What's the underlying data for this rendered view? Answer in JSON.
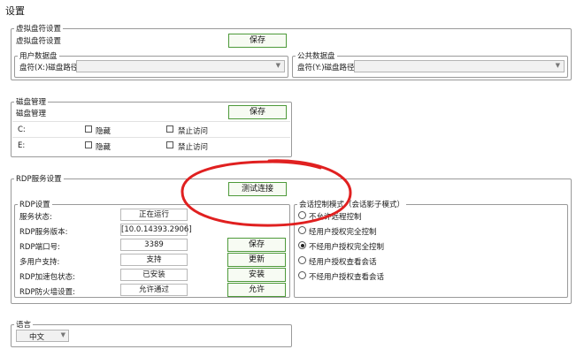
{
  "page": {
    "title": "设置"
  },
  "virtual_drive": {
    "group_title": "虚拟盘符设置",
    "label": "虚拟盘符设置",
    "save_label": "保存",
    "user_disk": {
      "group_title": "用户数据盘",
      "path_label": "盘符(X:)磁盘路径",
      "value": ""
    },
    "public_disk": {
      "group_title": "公共数据盘",
      "path_label": "盘符(Y:)磁盘路径",
      "value": ""
    }
  },
  "disk_manage": {
    "group_title": "磁盘管理",
    "label": "磁盘管理",
    "save_label": "保存",
    "rows": [
      {
        "drive": "C:",
        "hide_label": "隐藏",
        "hide_checked": false,
        "deny_label": "禁止访问",
        "deny_checked": false
      },
      {
        "drive": "E:",
        "hide_label": "隐藏",
        "hide_checked": false,
        "deny_label": "禁止访问",
        "deny_checked": false
      }
    ]
  },
  "rdp": {
    "group_title": "RDP服务设置",
    "test_button": "测试连接",
    "settings": {
      "group_title": "RDP设置",
      "rows": [
        {
          "label": "服务状态:",
          "value": "正在运行",
          "action": ""
        },
        {
          "label": "RDP服务版本:",
          "value": "[10.0.14393.2906]",
          "action": ""
        },
        {
          "label": "RDP端口号:",
          "value": "3389",
          "action": "保存"
        },
        {
          "label": "多用户支持:",
          "value": "支持",
          "action": "更新"
        },
        {
          "label": "RDP加速包状态:",
          "value": "已安装",
          "action": "安装"
        },
        {
          "label": "RDP防火墙设置:",
          "value": "允许通过",
          "action": "允许"
        }
      ]
    },
    "session": {
      "group_title": "会话控制模式（会话影子模式）",
      "options": [
        {
          "label": "不允许远程控制",
          "selected": false
        },
        {
          "label": "经用户授权完全控制",
          "selected": false
        },
        {
          "label": "不经用户授权完全控制",
          "selected": true
        },
        {
          "label": "经用户授权查看会话",
          "selected": false
        },
        {
          "label": "不经用户授权查看会话",
          "selected": false
        }
      ]
    }
  },
  "language": {
    "group_title": "语言",
    "value": "中文"
  },
  "annotation": {
    "color": "#e02020"
  }
}
